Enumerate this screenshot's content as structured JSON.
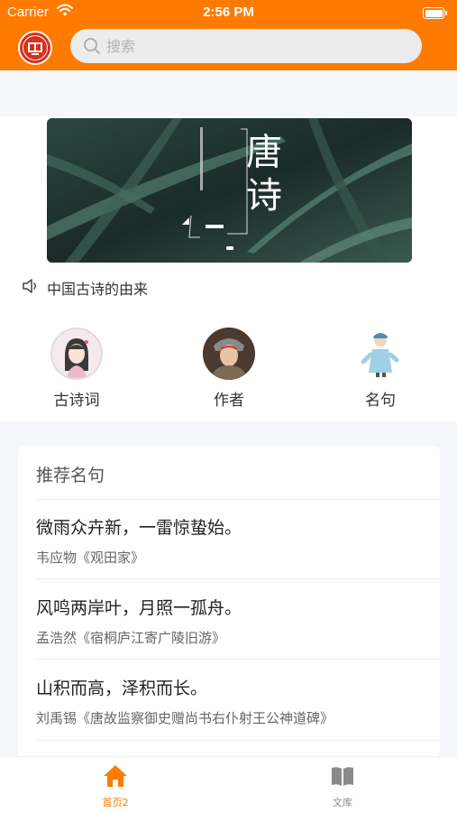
{
  "status_bar": {
    "carrier": "Carrier",
    "time": "2:56 PM"
  },
  "header": {
    "logo_icon": "app-logo-seal",
    "search_placeholder": "搜索",
    "accent_color": "#ff7a00"
  },
  "banner": {
    "title": "唐诗"
  },
  "notice": {
    "icon": "speaker-icon",
    "text": "中国古诗的由来"
  },
  "categories": [
    {
      "label": "古诗词",
      "icon": "ancient-lady-avatar"
    },
    {
      "label": "作者",
      "icon": "warrior-avatar"
    },
    {
      "label": "名句",
      "icon": "scholar-figure"
    }
  ],
  "recommend": {
    "title": "推荐名句",
    "quotes": [
      {
        "line": "微雨众卉新，一雷惊蛰始。",
        "source": "韦应物《观田家》"
      },
      {
        "line": "风鸣两岸叶，月照一孤舟。",
        "source": "孟浩然《宿桐庐江寄广陵旧游》"
      },
      {
        "line": "山积而高，泽积而长。",
        "source": "刘禹锡《唐故监察御史赠尚书右仆射王公神道碑》"
      }
    ]
  },
  "tabbar": {
    "tabs": [
      {
        "label": "首页2",
        "icon": "home-icon",
        "active": true,
        "color": "#ff7a00"
      },
      {
        "label": "文库",
        "icon": "book-icon",
        "active": false,
        "color": "#888888"
      }
    ]
  }
}
